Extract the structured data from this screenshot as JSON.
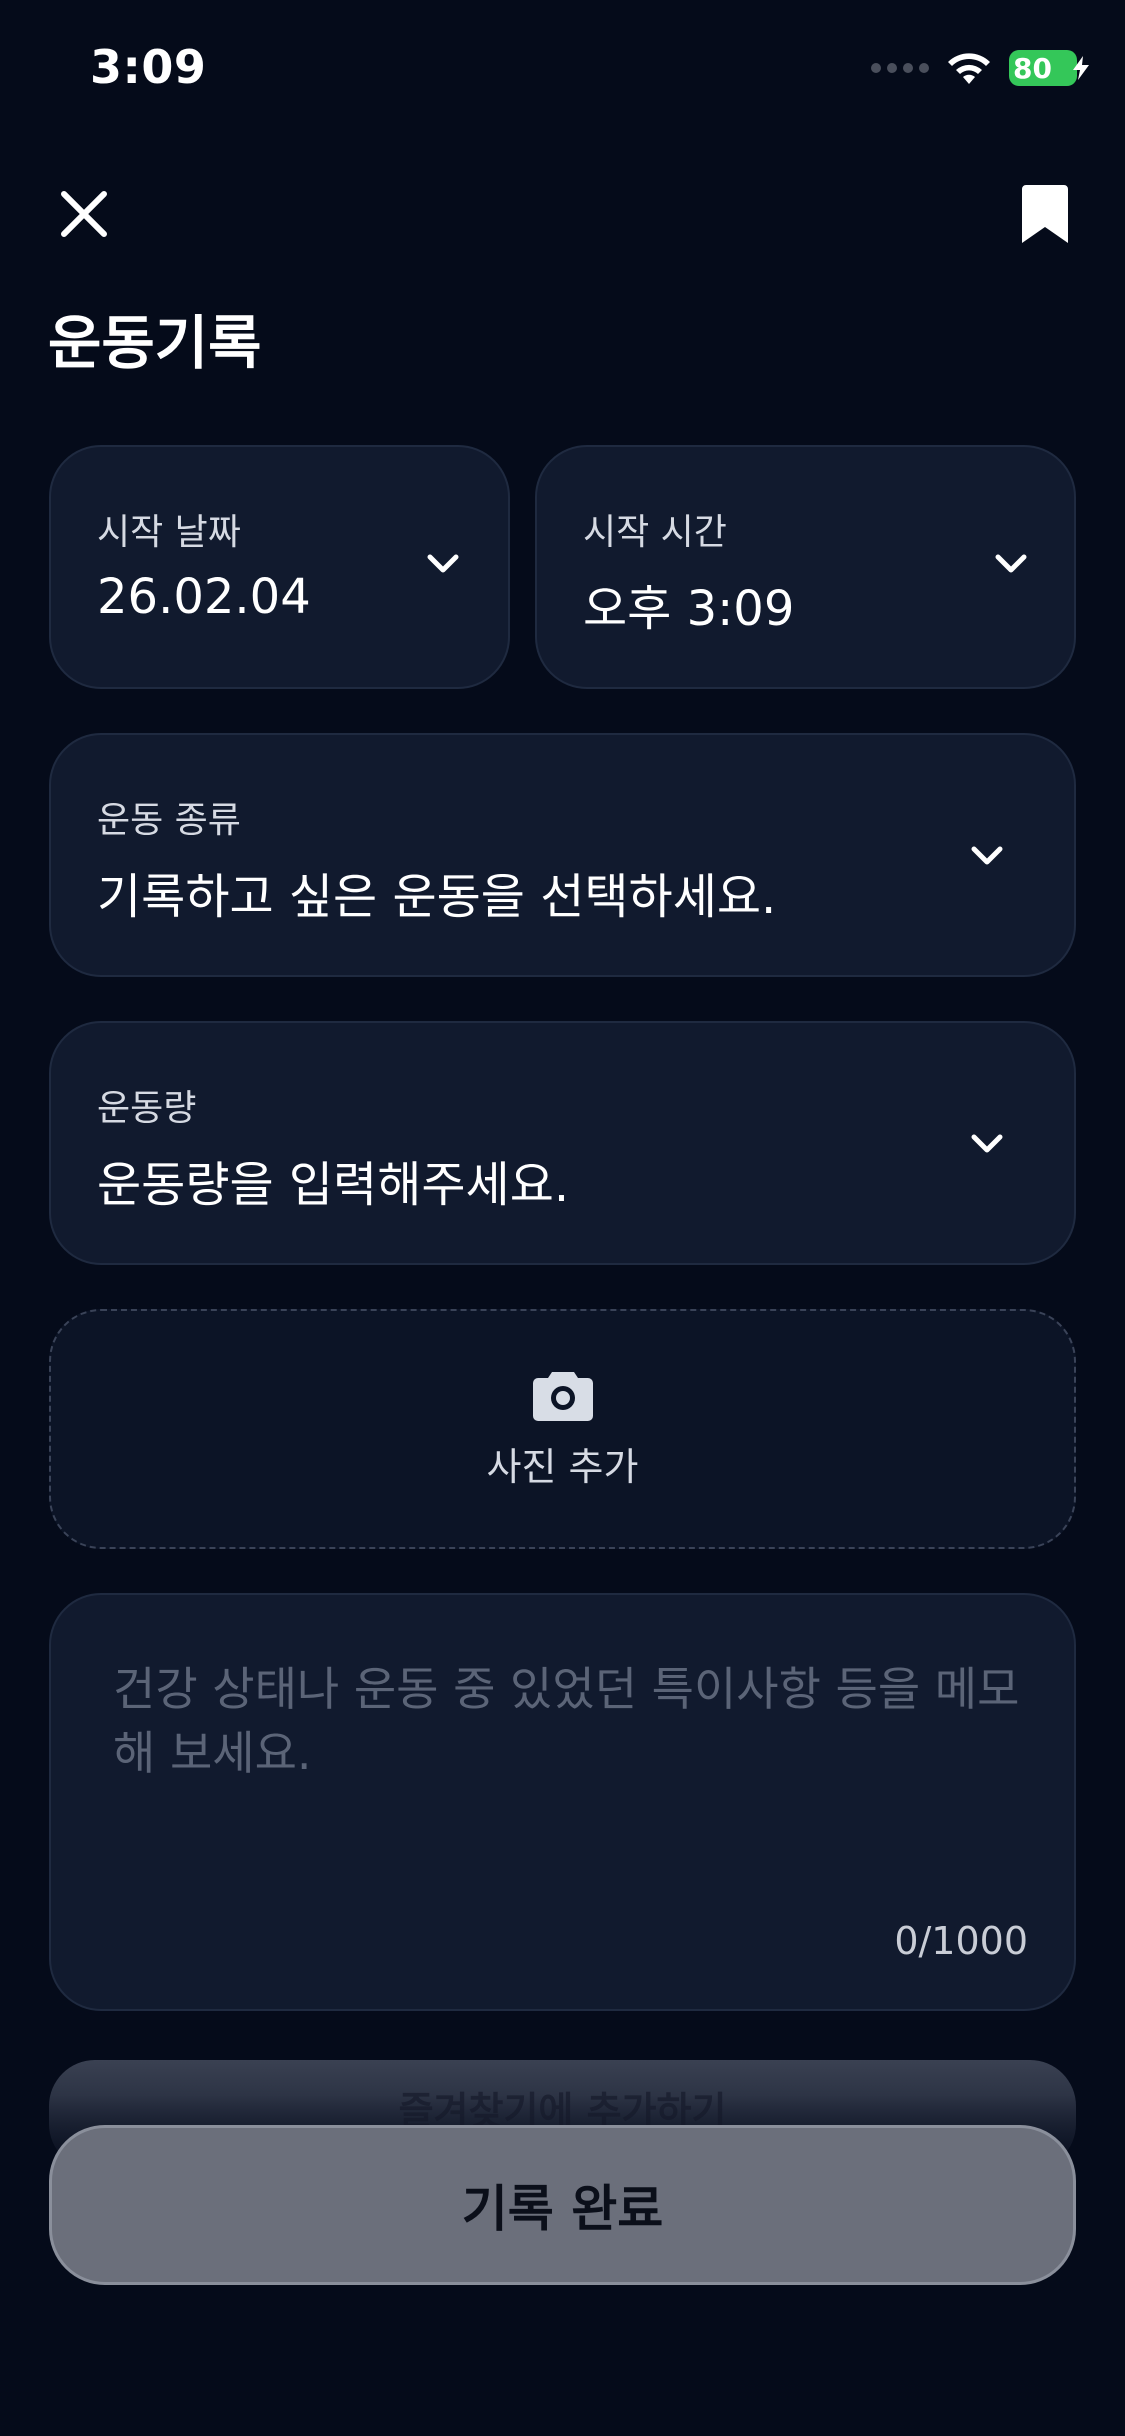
{
  "status_bar": {
    "time": "3:09",
    "battery": "80"
  },
  "header": {
    "title": "운동기록"
  },
  "start_date": {
    "label": "시작 날짜",
    "value": "26.02.04"
  },
  "start_time": {
    "label": "시작 시간",
    "value": "오후 3:09"
  },
  "exercise_type": {
    "label": "운동 종류",
    "value": "기록하고 싶은 운동을 선택하세요."
  },
  "exercise_amount": {
    "label": "운동량",
    "value": "운동량을 입력해주세요."
  },
  "photo": {
    "label": "사진 추가"
  },
  "memo": {
    "placeholder": "건강 상태나 운동 중 있었던 특이사항 등을 메모해 보세요.",
    "counter": "0/1000"
  },
  "buttons": {
    "favorite_label": "즐겨찾기에 추가하기",
    "done_label": "기록 완료"
  },
  "colors": {
    "background": "#050b1a",
    "card": "#111a2e",
    "battery": "#34c759",
    "done_button": "#6b6f7b"
  }
}
